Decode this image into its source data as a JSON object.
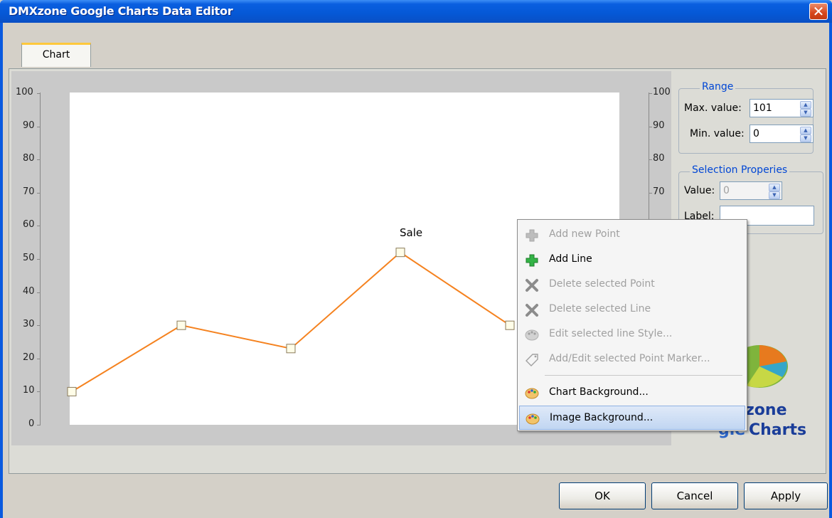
{
  "window": {
    "title": "DMXzone Google Charts Data Editor",
    "close_glyph": "✕"
  },
  "tabs": [
    {
      "label": "Chart"
    }
  ],
  "chart_data": {
    "type": "line",
    "title": "Sale",
    "xlabel": "",
    "ylabel": "",
    "ylim": [
      0,
      100
    ],
    "yticks": [
      "0",
      "10",
      "20",
      "30",
      "40",
      "50",
      "60",
      "70",
      "80",
      "90",
      "100"
    ],
    "right_ticks": [
      "70",
      "80",
      "90",
      "100"
    ],
    "grid": false,
    "series": [
      {
        "values": [
          10,
          30,
          23,
          52,
          30
        ],
        "color": "#f5821f"
      }
    ]
  },
  "range": {
    "title": "Range",
    "max_label": "Max. value:",
    "max_value": "101",
    "min_label": "Min. value:",
    "min_value": "0"
  },
  "selection": {
    "title": "Selection Properies",
    "value_label": "Value:",
    "value": "0",
    "label_label": "Label:",
    "label_value": ""
  },
  "logo": {
    "line1": "zone",
    "line2_prefix": "gle",
    "line2": "Charts"
  },
  "context_menu": {
    "items": [
      {
        "label": "Add new Point",
        "icon": "add-icon",
        "enabled": false
      },
      {
        "label": "Add Line",
        "icon": "add-icon",
        "enabled": true
      },
      {
        "label": "Delete selected Point",
        "icon": "delete-icon",
        "enabled": false
      },
      {
        "label": "Delete selected Line",
        "icon": "delete-icon",
        "enabled": false
      },
      {
        "label": "Edit selected line Style...",
        "icon": "palette-icon",
        "enabled": false
      },
      {
        "label": "Add/Edit selected Point Marker...",
        "icon": "tag-icon",
        "enabled": false
      },
      {
        "label": "Chart Background...",
        "icon": "palette-icon",
        "enabled": true
      },
      {
        "label": "Image Background...",
        "icon": "palette-icon",
        "enabled": true,
        "highlighted": true
      }
    ]
  },
  "buttons": {
    "ok": "OK",
    "cancel": "Cancel",
    "apply": "Apply"
  },
  "colors": {
    "accent": "#0a5adf",
    "series": "#f5821f",
    "group_title": "#0046d5"
  }
}
